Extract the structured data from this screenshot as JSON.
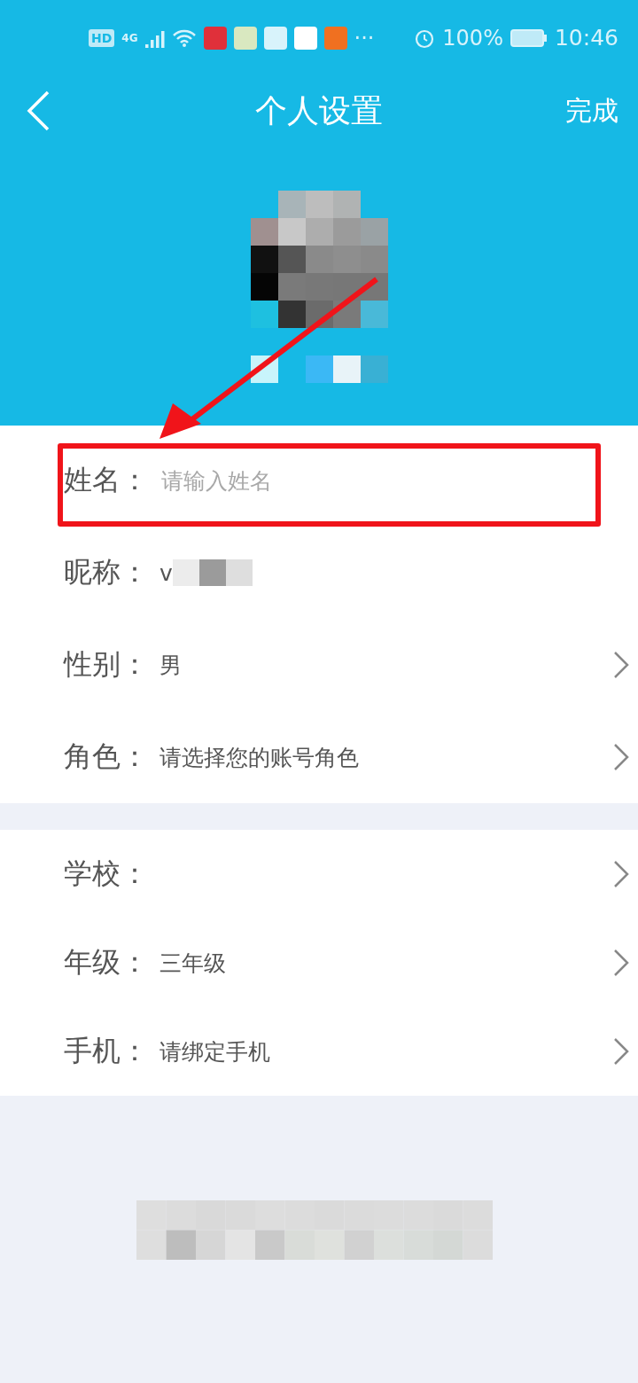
{
  "status_bar": {
    "network_badge": "HD",
    "network_type": "4G",
    "more": "···",
    "battery": "100%",
    "time": "10:46"
  },
  "header": {
    "title": "个人设置",
    "action": "完成"
  },
  "sections": [
    {
      "rows": [
        {
          "kind": "input",
          "label": "姓名：",
          "placeholder": "请输入姓名",
          "highlighted": true
        },
        {
          "kind": "masked",
          "label": "昵称：",
          "value": "v",
          "highlighted": false
        },
        {
          "kind": "select",
          "label": "性别：",
          "value": "男",
          "highlighted": false
        },
        {
          "kind": "select",
          "label": "角色：",
          "value": "请选择您的账号角色",
          "highlighted": false
        }
      ]
    },
    {
      "rows": [
        {
          "kind": "select",
          "label": "学校：",
          "highlighted": false
        },
        {
          "kind": "select",
          "label": "年级：",
          "value": "三年级",
          "highlighted": false
        },
        {
          "kind": "select",
          "label": "手机：",
          "value": "请绑定手机",
          "highlighted": false
        }
      ]
    }
  ]
}
